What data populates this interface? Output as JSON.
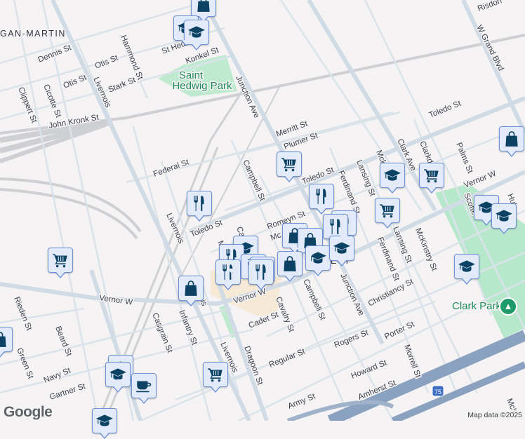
{
  "map": {
    "neighborhoods": {
      "hubbard": "GAN-MARTIN",
      "southwest": "EST"
    },
    "parks": {
      "saint_hedwig_1": "Saint",
      "saint_hedwig_2": "Hedwig Park",
      "clark": "Clark Park"
    },
    "streets": {
      "dennis": "Dennis St",
      "otis1": "Otis St",
      "otis2": "Otis St",
      "hammond": "Hammond St",
      "stark": "Stark St",
      "clippert": "Clippert St",
      "cicotte": "Cicotte St",
      "john_kronk": "John Kronk St",
      "livernois1": "Livernois",
      "livernois2": "Livernois",
      "livernois3": "Livernois",
      "livernois4": "Livernois",
      "st_hedwig": "St Hedwig",
      "konkel": "Konkel St",
      "junction1": "Junction Ave",
      "junction2": "Junction Ave",
      "federal": "Federal St",
      "campbell1": "Campbell St",
      "campbell2": "Campbell St",
      "merritt": "Merritt St",
      "plumer": "Plumer St",
      "toledo1": "Toledo St",
      "toledo2": "Toledo St",
      "toledo3": "Toledo St",
      "ferdinand1": "Ferdinand St",
      "ferdinand2": "Ferdinand St",
      "lansing1": "Lansing St",
      "lansing2": "Lansing St",
      "clark_ave": "Clark Ave",
      "clarkdale": "Clarkd",
      "palms": "Palms St",
      "vernor1": "Vernor W",
      "vernor2": "Vernor W",
      "vernor3": "Vernor W",
      "w_grand": "W Grand Blvd",
      "risdon": "Risdon",
      "romeyn": "Romeyn St",
      "mckinstry": "McKinstry St",
      "mck": "Mck",
      "scotten": "Scotte",
      "hubbard": "Hub",
      "christiancy": "Christiancy St",
      "porter": "Porter St",
      "rogers": "Rogers St",
      "morrell": "Morrell St",
      "cavalry": "Cavalry St",
      "cadet": "Cadet St",
      "regular": "Regular St",
      "howard": "Howard St",
      "amherst": "Amherst St",
      "army": "Army St",
      "dragoon": "Dragoon St",
      "casgrain": "Casgrain St",
      "infantry": "Infantry St",
      "rieden": "Rieden St",
      "beard": "Beard St",
      "green": "Green St",
      "navy": "Navy St",
      "gartner": "Gartner St",
      "mck_south": "McK",
      "ca": "Ca",
      "m": "M",
      "mc": "Mc"
    },
    "highway_shield": "75"
  },
  "footer": {
    "logo": "Google",
    "attribution": "Map data ©2025"
  },
  "colors": {
    "road": "#d3dde6",
    "park": "#b8e8cb",
    "highway": "#8aa2bf",
    "marker_bg": "#e3ebfb",
    "marker_icon": "#0b4264"
  }
}
